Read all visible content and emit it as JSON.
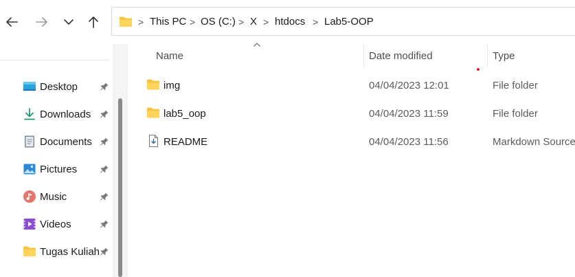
{
  "navigation": {
    "back_icon": "arrow-left-icon",
    "forward_icon": "arrow-right-icon",
    "recent_icon": "chevron-down-icon",
    "up_icon": "arrow-up-icon"
  },
  "address_bar": {
    "icon": "folder-icon",
    "crumbs": [
      "This PC",
      "OS (C:)",
      "X",
      "htdocs",
      "Lab5-OOP"
    ],
    "separator": ">"
  },
  "sidebar": {
    "items": [
      {
        "label": "Desktop",
        "icon": "desktop-icon",
        "pinned": true
      },
      {
        "label": "Downloads",
        "icon": "download-icon",
        "pinned": true
      },
      {
        "label": "Documents",
        "icon": "document-icon",
        "pinned": true
      },
      {
        "label": "Pictures",
        "icon": "pictures-icon",
        "pinned": true
      },
      {
        "label": "Music",
        "icon": "music-icon",
        "pinned": true
      },
      {
        "label": "Videos",
        "icon": "video-icon",
        "pinned": true
      },
      {
        "label": "Tugas Kuliah",
        "icon": "folder-icon",
        "pinned": true
      }
    ]
  },
  "columns": {
    "name": "Name",
    "date_modified": "Date modified",
    "type": "Type",
    "sort_column": "name"
  },
  "files": [
    {
      "name": "img",
      "date": "04/04/2023 12:01",
      "type": "File folder",
      "icon": "folder-icon"
    },
    {
      "name": "lab5_oop",
      "date": "04/04/2023 11:59",
      "type": "File folder",
      "icon": "folder-icon"
    },
    {
      "name": "README",
      "date": "04/04/2023 11:56",
      "type": "Markdown Source",
      "icon": "markdown-file-icon"
    }
  ],
  "colors": {
    "folder_yellow": "#f5c542",
    "accent_blue": "#1e6fd9",
    "scroll_thumb": "#8a8a8a"
  }
}
